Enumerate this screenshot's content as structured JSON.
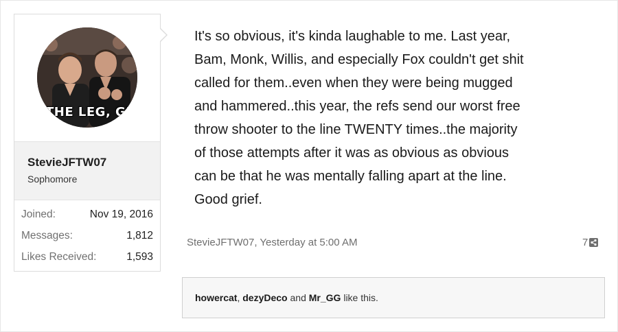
{
  "user": {
    "avatar_caption": "THE LEG, GR",
    "username": "StevieJFTW07",
    "title": "Sophomore",
    "stats": [
      {
        "label": "Joined:",
        "value": "Nov 19, 2016"
      },
      {
        "label": "Messages:",
        "value": "1,812"
      },
      {
        "label": "Likes Received:",
        "value": "1,593"
      }
    ]
  },
  "message": {
    "lines": [
      "It's so obvious, it's kinda laughable to me. Last year,",
      "Bam, Monk, Willis, and especially Fox couldn't get shit",
      "called for them..even when they were being mugged",
      "and hammered..this year, the refs send our worst free",
      "throw shooter to the line TWENTY times..the majority",
      "of those attempts after it was as obvious as obvious",
      "can be that he was mentally falling apart at the line.",
      "Good grief."
    ],
    "meta": "StevieJFTW07, Yesterday at 5:00 AM",
    "post_number": "7",
    "share_icon": "share-icon"
  },
  "likes": {
    "user1": "howercat",
    "sep1": ", ",
    "user2": "dezyDeco",
    "sep2": " and ",
    "user3": "Mr_GG",
    "suffix": " like this."
  }
}
